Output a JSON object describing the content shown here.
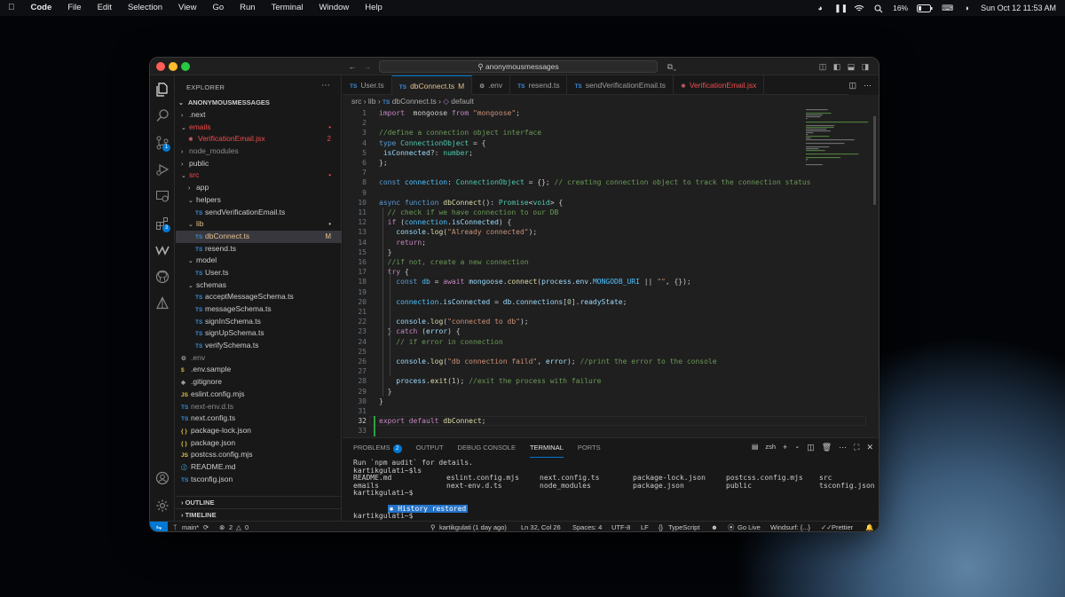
{
  "menubar": {
    "app": "Code",
    "items": [
      "File",
      "Edit",
      "Selection",
      "View",
      "Go",
      "Run",
      "Terminal",
      "Window",
      "Help"
    ],
    "battery": "16%",
    "datetime": "Sun Oct 12  11:53 AM"
  },
  "window": {
    "command_center": "anonymousmessages"
  },
  "activity_badges": {
    "source_control": "1",
    "extensions": "3"
  },
  "explorer": {
    "title": "EXPLORER",
    "root": "ANONYMOUSMESSAGES",
    "rows": [
      {
        "label": ".next",
        "depth": 1,
        "kind": "folder",
        "open": false
      },
      {
        "label": "emails",
        "depth": 1,
        "kind": "folder",
        "open": true,
        "status": "error",
        "marker": "•"
      },
      {
        "label": "VerificationEmail.jsx",
        "depth": 2,
        "kind": "react",
        "status": "error",
        "marker": "2"
      },
      {
        "label": "node_modules",
        "depth": 1,
        "kind": "folder",
        "open": false,
        "status": "dim"
      },
      {
        "label": "public",
        "depth": 1,
        "kind": "folder",
        "open": false
      },
      {
        "label": "src",
        "depth": 1,
        "kind": "folder",
        "open": true,
        "status": "error",
        "marker": "•"
      },
      {
        "label": "app",
        "depth": 2,
        "kind": "folder",
        "open": false
      },
      {
        "label": "helpers",
        "depth": 2,
        "kind": "folder",
        "open": true
      },
      {
        "label": "sendVerificationEmail.ts",
        "depth": 3,
        "kind": "ts"
      },
      {
        "label": "lib",
        "depth": 2,
        "kind": "folder",
        "open": true,
        "status": "modified",
        "marker": "•"
      },
      {
        "label": "dbConnect.ts",
        "depth": 3,
        "kind": "ts",
        "status": "modified",
        "marker": "M",
        "selected": true
      },
      {
        "label": "resend.ts",
        "depth": 3,
        "kind": "ts"
      },
      {
        "label": "model",
        "depth": 2,
        "kind": "folder",
        "open": true
      },
      {
        "label": "User.ts",
        "depth": 3,
        "kind": "ts"
      },
      {
        "label": "schemas",
        "depth": 2,
        "kind": "folder",
        "open": true
      },
      {
        "label": "acceptMessageSchema.ts",
        "depth": 3,
        "kind": "ts"
      },
      {
        "label": "messageSchema.ts",
        "depth": 3,
        "kind": "ts"
      },
      {
        "label": "signInSchema.ts",
        "depth": 3,
        "kind": "ts"
      },
      {
        "label": "signUpSchema.ts",
        "depth": 3,
        "kind": "ts"
      },
      {
        "label": "verifySchema.ts",
        "depth": 3,
        "kind": "ts"
      },
      {
        "label": ".env",
        "depth": 1,
        "kind": "gear",
        "status": "dim"
      },
      {
        "label": ".env.sample",
        "depth": 1,
        "kind": "dollar"
      },
      {
        "label": ".gitignore",
        "depth": 1,
        "kind": "git"
      },
      {
        "label": "eslint.config.mjs",
        "depth": 1,
        "kind": "js"
      },
      {
        "label": "next-env.d.ts",
        "depth": 1,
        "kind": "ts",
        "status": "dim"
      },
      {
        "label": "next.config.ts",
        "depth": 1,
        "kind": "ts"
      },
      {
        "label": "package-lock.json",
        "depth": 1,
        "kind": "json"
      },
      {
        "label": "package.json",
        "depth": 1,
        "kind": "json"
      },
      {
        "label": "postcss.config.mjs",
        "depth": 1,
        "kind": "js"
      },
      {
        "label": "README.md",
        "depth": 1,
        "kind": "info"
      },
      {
        "label": "tsconfig.json",
        "depth": 1,
        "kind": "tsjson"
      }
    ],
    "outline": "OUTLINE",
    "timeline": "TIMELINE"
  },
  "tabs": [
    {
      "label": "User.ts",
      "icon": "TS",
      "active": false
    },
    {
      "label": "dbConnect.ts",
      "icon": "TS",
      "active": true,
      "suffix": "M"
    },
    {
      "label": ".env",
      "icon": "gear",
      "active": false
    },
    {
      "label": "resend.ts",
      "icon": "TS",
      "active": false
    },
    {
      "label": "sendVerificationEmail.ts",
      "icon": "TS",
      "active": false
    },
    {
      "label": "VerificationEmail.jsx",
      "icon": "react",
      "active": false
    }
  ],
  "breadcrumb": {
    "src": "src",
    "lib": "lib",
    "file": "dbConnect.ts",
    "symbol": "default"
  },
  "code_lines": [
    [
      [
        "kc",
        "import"
      ],
      [
        "",
        "  mongoose "
      ],
      [
        "kc",
        "from"
      ],
      [
        "str",
        " \"mongoose\""
      ],
      [
        "",
        ";"
      ]
    ],
    [],
    [
      [
        "cmt",
        "//define a connection object interface"
      ]
    ],
    [
      [
        "kw",
        "type"
      ],
      [
        "",
        " "
      ],
      [
        "ty",
        "ConnectionObject"
      ],
      [
        "",
        " = {"
      ]
    ],
    [
      [
        "",
        " "
      ],
      [
        "vr",
        "isConnected"
      ],
      [
        "",
        "?: "
      ],
      [
        "ty",
        "number"
      ],
      [
        "",
        ";"
      ]
    ],
    [
      [
        "",
        "};"
      ]
    ],
    [],
    [
      [
        "kw",
        "const"
      ],
      [
        "",
        " "
      ],
      [
        "cst",
        "connection"
      ],
      [
        "",
        ": "
      ],
      [
        "ty",
        "ConnectionObject"
      ],
      [
        "",
        " = {}; "
      ],
      [
        "cmt",
        "// creating connection object to track the connection status"
      ]
    ],
    [],
    [
      [
        "kw",
        "async"
      ],
      [
        "",
        " "
      ],
      [
        "kw",
        "function"
      ],
      [
        "",
        " "
      ],
      [
        "fn",
        "dbConnect"
      ],
      [
        "",
        "(): "
      ],
      [
        "ty",
        "Promise"
      ],
      [
        "",
        "<"
      ],
      [
        "ty",
        "void"
      ],
      [
        "",
        "> {"
      ]
    ],
    [
      [
        "",
        "  "
      ],
      [
        "cmt",
        "// check if we have connection to our DB"
      ]
    ],
    [
      [
        "",
        "  "
      ],
      [
        "kc",
        "if"
      ],
      [
        "",
        " ("
      ],
      [
        "cst",
        "connection"
      ],
      [
        "",
        "."
      ],
      [
        "vr",
        "isConnected"
      ],
      [
        "",
        ") {"
      ]
    ],
    [
      [
        "",
        "    "
      ],
      [
        "vr",
        "console"
      ],
      [
        "",
        "."
      ],
      [
        "fn",
        "log"
      ],
      [
        "",
        "("
      ],
      [
        "str",
        "\"Already connected\""
      ],
      [
        "",
        ");"
      ]
    ],
    [
      [
        "",
        "    "
      ],
      [
        "kc",
        "return"
      ],
      [
        "",
        ";"
      ]
    ],
    [
      [
        "",
        "  }"
      ]
    ],
    [
      [
        "",
        "  "
      ],
      [
        "cmt",
        "//if not, create a new connection"
      ]
    ],
    [
      [
        "",
        "  "
      ],
      [
        "kc",
        "try"
      ],
      [
        "",
        " {"
      ]
    ],
    [
      [
        "",
        "    "
      ],
      [
        "kw",
        "const"
      ],
      [
        "",
        " "
      ],
      [
        "cst",
        "db"
      ],
      [
        "",
        " = "
      ],
      [
        "kc",
        "await"
      ],
      [
        "",
        " "
      ],
      [
        "vr",
        "mongoose"
      ],
      [
        "",
        "."
      ],
      [
        "fn",
        "connect"
      ],
      [
        "",
        "("
      ],
      [
        "vr",
        "process"
      ],
      [
        "",
        "."
      ],
      [
        "vr",
        "env"
      ],
      [
        "",
        "."
      ],
      [
        "cst",
        "MONGODB_URI"
      ],
      [
        "",
        " || "
      ],
      [
        "str",
        "\"\""
      ],
      [
        "",
        ", {});"
      ]
    ],
    [],
    [
      [
        "",
        "    "
      ],
      [
        "cst",
        "connection"
      ],
      [
        "",
        "."
      ],
      [
        "vr",
        "isConnected"
      ],
      [
        "",
        " = "
      ],
      [
        "vr",
        "db"
      ],
      [
        "",
        "."
      ],
      [
        "vr",
        "connections"
      ],
      [
        "",
        "["
      ],
      [
        "num",
        "0"
      ],
      [
        "",
        "]."
      ],
      [
        "vr",
        "readyState"
      ],
      [
        "",
        ";"
      ]
    ],
    [],
    [
      [
        "",
        "    "
      ],
      [
        "vr",
        "console"
      ],
      [
        "",
        "."
      ],
      [
        "fn",
        "log"
      ],
      [
        "",
        "("
      ],
      [
        "str",
        "\"connected to db\""
      ],
      [
        "",
        ");"
      ]
    ],
    [
      [
        "",
        "  } "
      ],
      [
        "kc",
        "catch"
      ],
      [
        "",
        " ("
      ],
      [
        "vr",
        "error"
      ],
      [
        "",
        ") {"
      ]
    ],
    [
      [
        "",
        "    "
      ],
      [
        "cmt",
        "// if error in connection"
      ]
    ],
    [],
    [
      [
        "",
        "    "
      ],
      [
        "vr",
        "console"
      ],
      [
        "",
        "."
      ],
      [
        "fn",
        "log"
      ],
      [
        "",
        "("
      ],
      [
        "str",
        "\"db connection faild\""
      ],
      [
        "",
        ", "
      ],
      [
        "vr",
        "error"
      ],
      [
        "",
        "); "
      ],
      [
        "cmt",
        "//print the error to the console"
      ]
    ],
    [],
    [
      [
        "",
        "    "
      ],
      [
        "vr",
        "process"
      ],
      [
        "",
        "."
      ],
      [
        "fn",
        "exit"
      ],
      [
        "",
        "("
      ],
      [
        "num",
        "1"
      ],
      [
        "",
        "); "
      ],
      [
        "cmt",
        "//exit the process with failure"
      ]
    ],
    [
      [
        "",
        "  }"
      ]
    ],
    [
      [
        "",
        "}"
      ]
    ],
    [],
    [
      [
        "kc",
        "export"
      ],
      [
        "",
        " "
      ],
      [
        "kc",
        "default"
      ],
      [
        "",
        " "
      ],
      [
        "fn",
        "dbConnect"
      ],
      [
        "",
        ";"
      ]
    ],
    []
  ],
  "current_line": 32,
  "panel": {
    "tabs": [
      {
        "label": "PROBLEMS",
        "badge": "2"
      },
      {
        "label": "OUTPUT"
      },
      {
        "label": "DEBUG CONSOLE"
      },
      {
        "label": "TERMINAL",
        "active": true
      },
      {
        "label": "PORTS"
      }
    ],
    "shell": "zsh",
    "terminal": {
      "line1": "Run `npm audit` for details.",
      "line2": "kartikgulati~$ls",
      "ls_row1": [
        "README.md",
        "eslint.config.mjs",
        "next.config.ts",
        "package-lock.json",
        "postcss.config.mjs",
        "src"
      ],
      "ls_row2": [
        "emails",
        "next-env.d.ts",
        "node_modules",
        "package.json",
        "public",
        "tsconfig.json"
      ],
      "prompt1": "kartikgulati~$",
      "restored_icon": "✱",
      "restored": "History restored",
      "prompt2": "kartikgulati~$"
    }
  },
  "statusbar": {
    "branch": "main*",
    "errors": "2",
    "warnings": "0",
    "blame": "kartikgulati (1 day ago)",
    "position": "Ln 32, Col 26",
    "spaces": "Spaces: 4",
    "encoding": "UTF-8",
    "eol": "LF",
    "language": "TypeScript",
    "golive": "Go Live",
    "windsurf": "Windsurf: {...}",
    "prettier": "Prettier"
  },
  "colors": {
    "accent": "#0078d4",
    "error": "#f14c4c",
    "modified": "#e2c08d"
  }
}
